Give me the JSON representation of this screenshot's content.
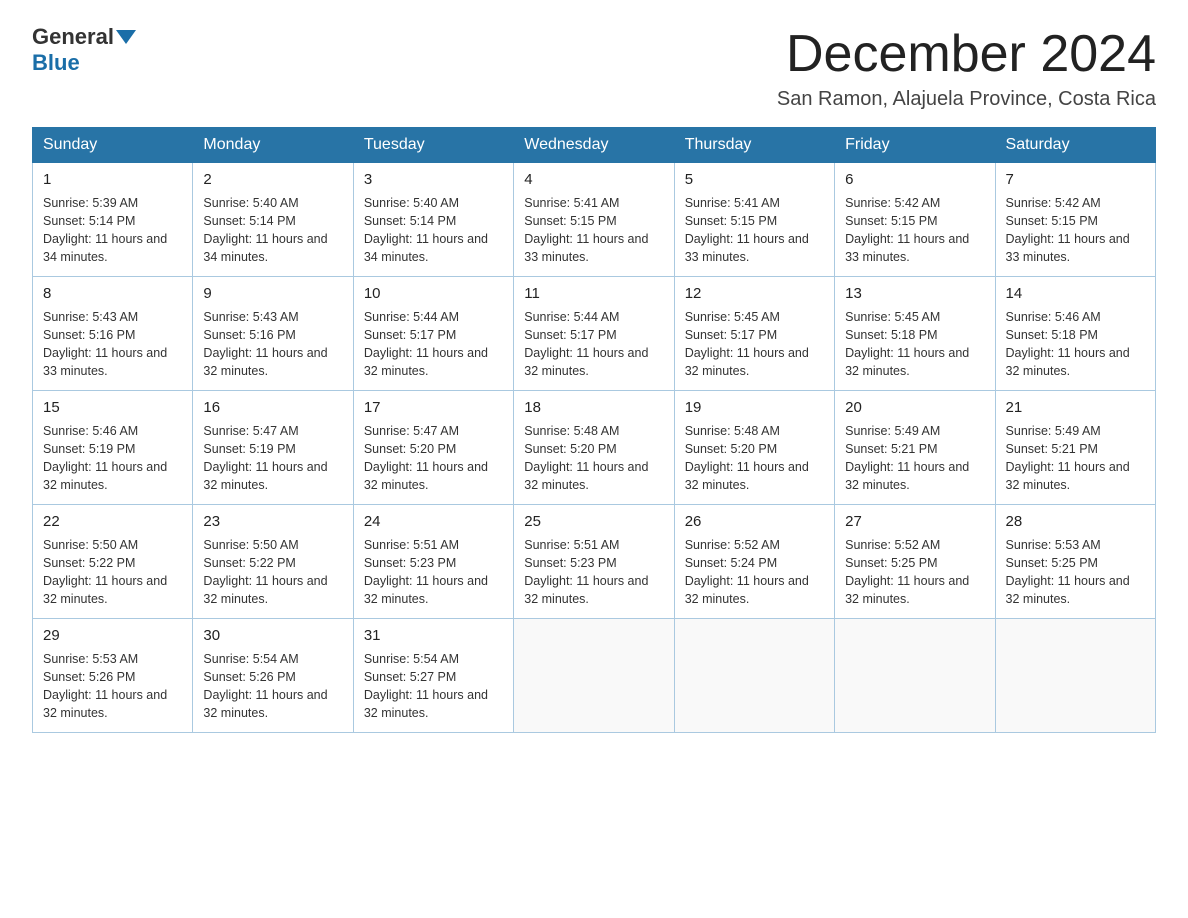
{
  "header": {
    "logo_general": "General",
    "logo_blue": "Blue",
    "month_title": "December 2024",
    "location": "San Ramon, Alajuela Province, Costa Rica"
  },
  "weekdays": [
    "Sunday",
    "Monday",
    "Tuesday",
    "Wednesday",
    "Thursday",
    "Friday",
    "Saturday"
  ],
  "weeks": [
    [
      {
        "day": "1",
        "sunrise": "5:39 AM",
        "sunset": "5:14 PM",
        "daylight": "11 hours and 34 minutes."
      },
      {
        "day": "2",
        "sunrise": "5:40 AM",
        "sunset": "5:14 PM",
        "daylight": "11 hours and 34 minutes."
      },
      {
        "day": "3",
        "sunrise": "5:40 AM",
        "sunset": "5:14 PM",
        "daylight": "11 hours and 34 minutes."
      },
      {
        "day": "4",
        "sunrise": "5:41 AM",
        "sunset": "5:15 PM",
        "daylight": "11 hours and 33 minutes."
      },
      {
        "day": "5",
        "sunrise": "5:41 AM",
        "sunset": "5:15 PM",
        "daylight": "11 hours and 33 minutes."
      },
      {
        "day": "6",
        "sunrise": "5:42 AM",
        "sunset": "5:15 PM",
        "daylight": "11 hours and 33 minutes."
      },
      {
        "day": "7",
        "sunrise": "5:42 AM",
        "sunset": "5:15 PM",
        "daylight": "11 hours and 33 minutes."
      }
    ],
    [
      {
        "day": "8",
        "sunrise": "5:43 AM",
        "sunset": "5:16 PM",
        "daylight": "11 hours and 33 minutes."
      },
      {
        "day": "9",
        "sunrise": "5:43 AM",
        "sunset": "5:16 PM",
        "daylight": "11 hours and 32 minutes."
      },
      {
        "day": "10",
        "sunrise": "5:44 AM",
        "sunset": "5:17 PM",
        "daylight": "11 hours and 32 minutes."
      },
      {
        "day": "11",
        "sunrise": "5:44 AM",
        "sunset": "5:17 PM",
        "daylight": "11 hours and 32 minutes."
      },
      {
        "day": "12",
        "sunrise": "5:45 AM",
        "sunset": "5:17 PM",
        "daylight": "11 hours and 32 minutes."
      },
      {
        "day": "13",
        "sunrise": "5:45 AM",
        "sunset": "5:18 PM",
        "daylight": "11 hours and 32 minutes."
      },
      {
        "day": "14",
        "sunrise": "5:46 AM",
        "sunset": "5:18 PM",
        "daylight": "11 hours and 32 minutes."
      }
    ],
    [
      {
        "day": "15",
        "sunrise": "5:46 AM",
        "sunset": "5:19 PM",
        "daylight": "11 hours and 32 minutes."
      },
      {
        "day": "16",
        "sunrise": "5:47 AM",
        "sunset": "5:19 PM",
        "daylight": "11 hours and 32 minutes."
      },
      {
        "day": "17",
        "sunrise": "5:47 AM",
        "sunset": "5:20 PM",
        "daylight": "11 hours and 32 minutes."
      },
      {
        "day": "18",
        "sunrise": "5:48 AM",
        "sunset": "5:20 PM",
        "daylight": "11 hours and 32 minutes."
      },
      {
        "day": "19",
        "sunrise": "5:48 AM",
        "sunset": "5:20 PM",
        "daylight": "11 hours and 32 minutes."
      },
      {
        "day": "20",
        "sunrise": "5:49 AM",
        "sunset": "5:21 PM",
        "daylight": "11 hours and 32 minutes."
      },
      {
        "day": "21",
        "sunrise": "5:49 AM",
        "sunset": "5:21 PM",
        "daylight": "11 hours and 32 minutes."
      }
    ],
    [
      {
        "day": "22",
        "sunrise": "5:50 AM",
        "sunset": "5:22 PM",
        "daylight": "11 hours and 32 minutes."
      },
      {
        "day": "23",
        "sunrise": "5:50 AM",
        "sunset": "5:22 PM",
        "daylight": "11 hours and 32 minutes."
      },
      {
        "day": "24",
        "sunrise": "5:51 AM",
        "sunset": "5:23 PM",
        "daylight": "11 hours and 32 minutes."
      },
      {
        "day": "25",
        "sunrise": "5:51 AM",
        "sunset": "5:23 PM",
        "daylight": "11 hours and 32 minutes."
      },
      {
        "day": "26",
        "sunrise": "5:52 AM",
        "sunset": "5:24 PM",
        "daylight": "11 hours and 32 minutes."
      },
      {
        "day": "27",
        "sunrise": "5:52 AM",
        "sunset": "5:25 PM",
        "daylight": "11 hours and 32 minutes."
      },
      {
        "day": "28",
        "sunrise": "5:53 AM",
        "sunset": "5:25 PM",
        "daylight": "11 hours and 32 minutes."
      }
    ],
    [
      {
        "day": "29",
        "sunrise": "5:53 AM",
        "sunset": "5:26 PM",
        "daylight": "11 hours and 32 minutes."
      },
      {
        "day": "30",
        "sunrise": "5:54 AM",
        "sunset": "5:26 PM",
        "daylight": "11 hours and 32 minutes."
      },
      {
        "day": "31",
        "sunrise": "5:54 AM",
        "sunset": "5:27 PM",
        "daylight": "11 hours and 32 minutes."
      },
      null,
      null,
      null,
      null
    ]
  ],
  "labels": {
    "sunrise_prefix": "Sunrise: ",
    "sunset_prefix": "Sunset: ",
    "daylight_prefix": "Daylight: "
  }
}
